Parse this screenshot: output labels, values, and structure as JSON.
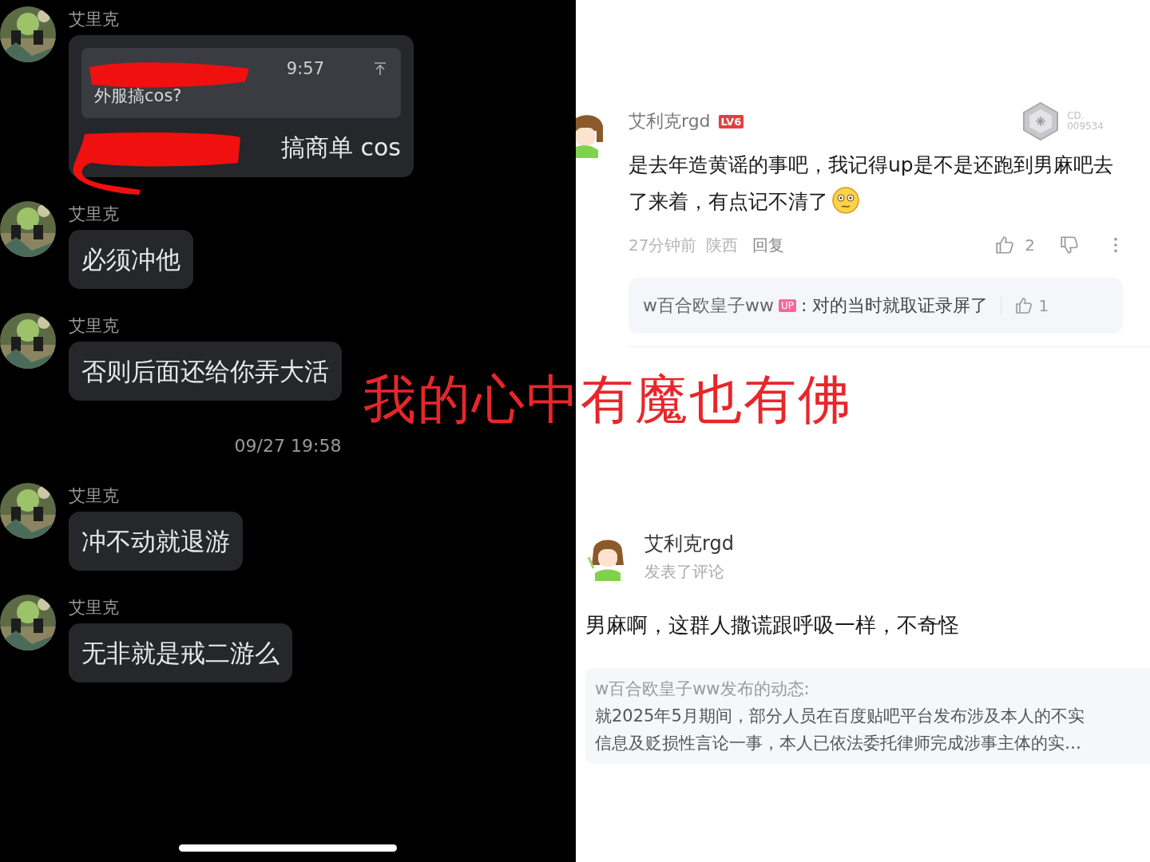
{
  "chat": {
    "items": [
      {
        "kind": "quote",
        "sender": "艾里克",
        "quote_time": "9:57",
        "quote_text": "外服搞cos?",
        "text": "搞商单 cos"
      },
      {
        "kind": "text",
        "sender": "艾里克",
        "text": "必须冲他"
      },
      {
        "kind": "text",
        "sender": "艾里克",
        "text": "否则后面还给你弄大活"
      },
      {
        "kind": "time",
        "text": "09/27 19:58"
      },
      {
        "kind": "text",
        "sender": "艾里克",
        "text": "冲不动就退游"
      },
      {
        "kind": "text",
        "sender": "艾里克",
        "text": "无非就是戒二游么"
      }
    ]
  },
  "comment": {
    "user": "艾利克rgd",
    "level_badge": "LV6",
    "medal_code": [
      "CD.",
      "009534"
    ],
    "text": "是去年造黄谣的事吧，我记得up是不是还跑到男麻吧去了来着，有点记不清了",
    "time": "27分钟前",
    "location": "陕西",
    "reply": "回复",
    "likes": "2",
    "reply_preview": {
      "author": "w百合欧皇子ww",
      "author_badge": "UP",
      "text": ": 对的当时就取证录屏了",
      "likes": "1"
    }
  },
  "post": {
    "user": "艾利克rgd",
    "action": "发表了评论",
    "text": "男麻啊，这群人撒谎跟呼吸一样，不奇怪",
    "quote": {
      "header": "w百合欧皇子ww发布的动态:",
      "body_lines": [
        "就2025年5月期间，部分人员在百度贴吧平台发布涉及本人的不实",
        "信息及贬损性言论一事，本人已依法委托律师完成涉事主体的实…"
      ]
    }
  },
  "caption": "我的心中有魔也有佛"
}
